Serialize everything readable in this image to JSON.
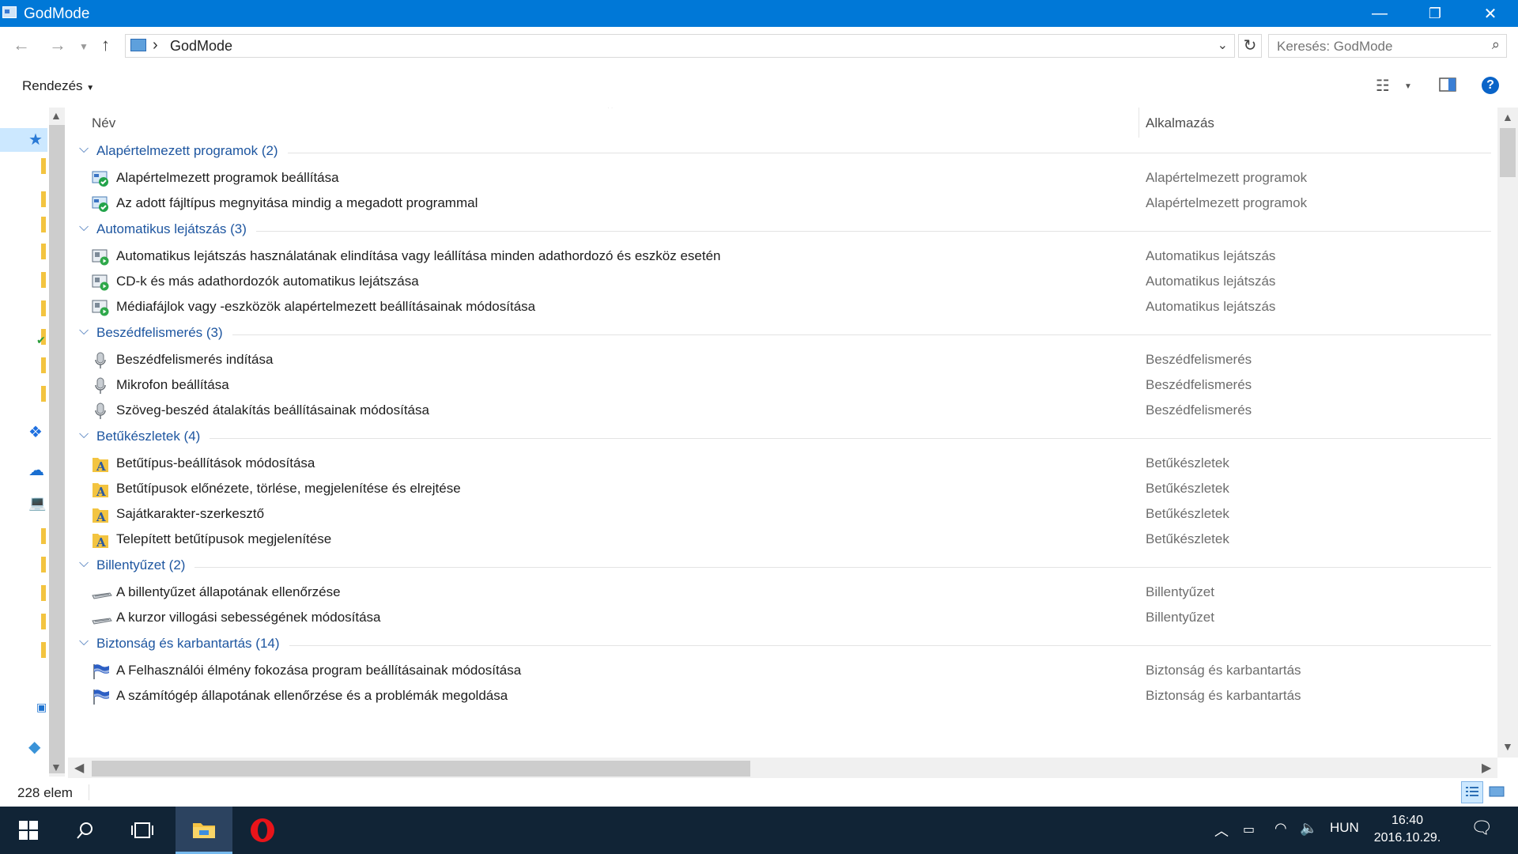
{
  "window": {
    "title": "GodMode",
    "minimize_glyph": "—",
    "restore_glyph": "❐",
    "close_glyph": "✕"
  },
  "address": {
    "breadcrumb": "GodMode",
    "search_placeholder": "Keresés: GodMode"
  },
  "toolbar": {
    "sort_label": "Rendezés"
  },
  "columns": {
    "name": "Név",
    "app": "Alkalmazás"
  },
  "groups": [
    {
      "name": "Alapértelmezett programok (2)",
      "icon": "default-programs-icon",
      "items": [
        {
          "name": "Alapértelmezett programok beállítása",
          "app": "Alapértelmezett programok"
        },
        {
          "name": "Az adott fájltípus megnyitása mindig a megadott programmal",
          "app": "Alapértelmezett programok"
        }
      ]
    },
    {
      "name": "Automatikus lejátszás (3)",
      "icon": "autoplay-icon",
      "items": [
        {
          "name": "Automatikus lejátszás használatának elindítása vagy leállítása minden adathordozó és eszköz esetén",
          "app": "Automatikus lejátszás"
        },
        {
          "name": "CD-k és más adathordozók automatikus lejátszása",
          "app": "Automatikus lejátszás"
        },
        {
          "name": "Médiafájlok vagy -eszközök alapértelmezett beállításainak módosítása",
          "app": "Automatikus lejátszás"
        }
      ]
    },
    {
      "name": "Beszédfelismerés (3)",
      "icon": "microphone-icon",
      "items": [
        {
          "name": "Beszédfelismerés indítása",
          "app": "Beszédfelismerés"
        },
        {
          "name": "Mikrofon beállítása",
          "app": "Beszédfelismerés"
        },
        {
          "name": "Szöveg-beszéd átalakítás beállításainak módosítása",
          "app": "Beszédfelismerés"
        }
      ]
    },
    {
      "name": "Betűkészletek (4)",
      "icon": "font-folder-icon",
      "items": [
        {
          "name": "Betűtípus-beállítások módosítása",
          "app": "Betűkészletek"
        },
        {
          "name": "Betűtípusok előnézete, törlése, megjelenítése és elrejtése",
          "app": "Betűkészletek"
        },
        {
          "name": "Sajátkarakter-szerkesztő",
          "app": "Betűkészletek"
        },
        {
          "name": "Telepített betűtípusok megjelenítése",
          "app": "Betűkészletek"
        }
      ]
    },
    {
      "name": "Billentyűzet (2)",
      "icon": "keyboard-icon",
      "items": [
        {
          "name": "A billentyűzet állapotának ellenőrzése",
          "app": "Billentyűzet"
        },
        {
          "name": "A kurzor villogási sebességének módosítása",
          "app": "Billentyűzet"
        }
      ]
    },
    {
      "name": "Biztonság és karbantartás (14)",
      "icon": "flag-icon",
      "items": [
        {
          "name": "A Felhasználói élmény fokozása program beállításainak módosítása",
          "app": "Biztonság és karbantartás"
        },
        {
          "name": "A számítógép állapotának ellenőrzése és a problémák megoldása",
          "app": "Biztonság és karbantartás"
        }
      ]
    }
  ],
  "status": {
    "item_count": "228 elem"
  },
  "taskbar": {
    "language": "HUN",
    "time": "16:40",
    "date": "2016.10.29."
  },
  "colors": {
    "titlebar": "#0078d7",
    "group_text": "#1e56a0",
    "taskbar": "#112436"
  }
}
